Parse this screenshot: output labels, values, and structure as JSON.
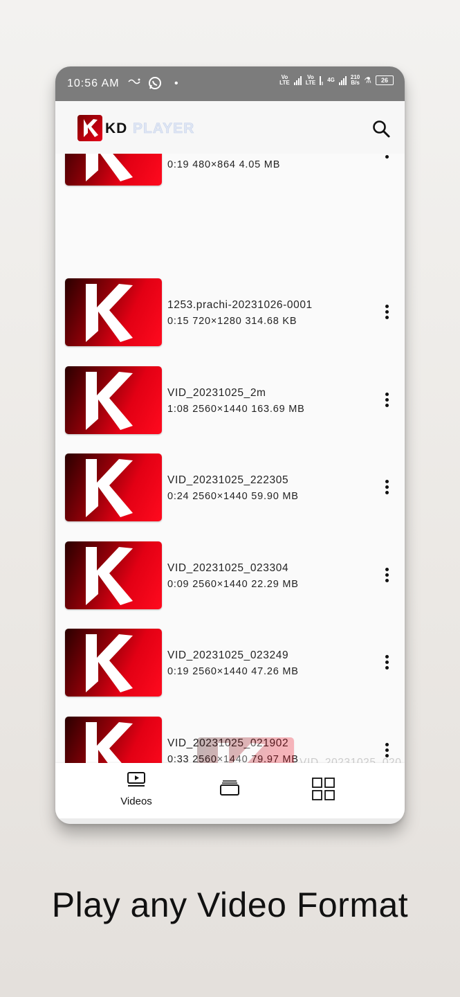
{
  "status_bar": {
    "time": "10:56 AM",
    "network_speed_value": "210",
    "network_speed_unit": "B/s",
    "battery": "26",
    "volte_label": "Vo\nLTE",
    "network_type": "4G"
  },
  "app": {
    "logo_text_1": "KD",
    "logo_text_2": "PLAYER"
  },
  "videos": [
    {
      "title": "",
      "duration": "0:19",
      "resolution": "480×864",
      "size": "4.05 MB"
    },
    {
      "title": "1253.prachi-20231026-0001",
      "duration": "0:15",
      "resolution": "720×1280",
      "size": "314.68 KB"
    },
    {
      "title": "VID_20231025_2m",
      "duration": "1:08",
      "resolution": "2560×1440",
      "size": "163.69 MB"
    },
    {
      "title": "VID_20231025_222305",
      "duration": "0:24",
      "resolution": "2560×1440",
      "size": "59.90 MB"
    },
    {
      "title": "VID_20231025_023304",
      "duration": "0:09",
      "resolution": "2560×1440",
      "size": "22.29 MB"
    },
    {
      "title": "VID_20231025_023249",
      "duration": "0:19",
      "resolution": "2560×1440",
      "size": "47.26 MB"
    },
    {
      "title": "VID_20231025_021902",
      "duration": "0:33",
      "resolution": "2560×1440",
      "size": "79.97 MB"
    },
    {
      "title": "VID_20231025_020",
      "duration": "",
      "resolution": "",
      "size": ""
    }
  ],
  "bottom_nav": {
    "videos_label": "Videos"
  },
  "tagline": "Play any Video Format",
  "colors": {
    "accent_red": "#e20014",
    "status_bar": "#7c7c7c"
  }
}
